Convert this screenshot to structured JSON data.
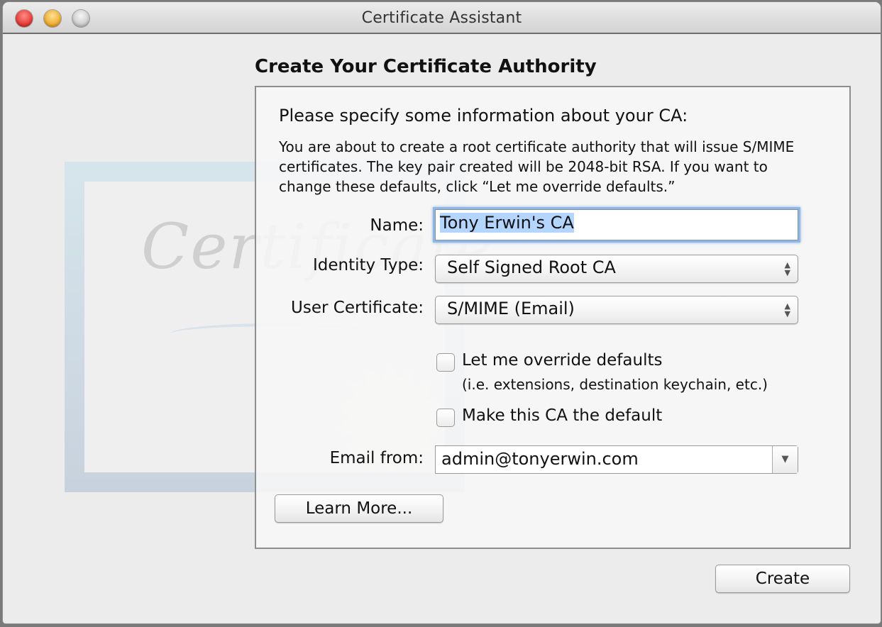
{
  "window": {
    "title": "Certificate Assistant",
    "traffic_lights": [
      "close",
      "minimize",
      "zoom"
    ]
  },
  "decoration": {
    "certificate_word": "Certificate"
  },
  "page": {
    "heading": "Create Your Certificate Authority",
    "subtitle": "Please specify some information about your CA:",
    "description": "You are about to create a root certificate authority that will issue S/MIME certificates. The key pair created will be 2048-bit RSA. If you want to change these defaults, click “Let me override defaults.”"
  },
  "form": {
    "name_label": "Name:",
    "name_value": "Tony Erwin's CA",
    "identity_type_label": "Identity Type:",
    "identity_type_value": "Self Signed Root CA",
    "user_certificate_label": "User Certificate:",
    "user_certificate_value": "S/MIME (Email)",
    "override_label": "Let me override defaults",
    "override_hint": "(i.e. extensions, destination keychain, etc.)",
    "override_checked": false,
    "default_ca_label": "Make this CA the default",
    "default_ca_checked": false,
    "email_from_label": "Email from:",
    "email_from_value": "admin@tonyerwin.com"
  },
  "buttons": {
    "learn_more": "Learn More...",
    "create": "Create"
  },
  "icons": {
    "popup_arrows": "▲▼",
    "combo_arrow": "▼"
  },
  "colors": {
    "selection_highlight": "#b4d5fe",
    "focus_ring": "#8db7e6",
    "close_light": "#e0332c",
    "minimize_light": "#eba623",
    "zoom_light": "#c8c8c8"
  }
}
